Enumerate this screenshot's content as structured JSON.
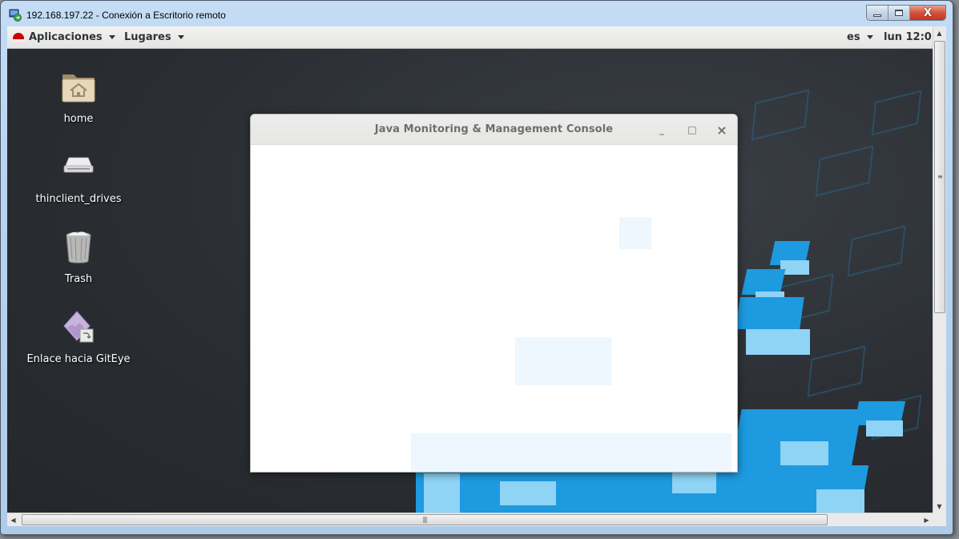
{
  "rdp_window": {
    "title": "192.168.197.22 - Conexión a Escritorio remoto",
    "icon": "remote-desktop-icon",
    "controls": {
      "minimize": "minimize-icon",
      "maximize": "maximize-icon",
      "close": "close-icon",
      "close_glyph": "X"
    }
  },
  "gnome_bar": {
    "menus": [
      {
        "label": "Aplicaciones",
        "icon": "redhat-icon"
      },
      {
        "label": "Lugares"
      }
    ],
    "language": "es",
    "clock": "lun 12:0"
  },
  "desktop": {
    "icons": [
      {
        "label": "home",
        "icon": "home-folder-icon"
      },
      {
        "label": "thinclient_drives",
        "icon": "drive-icon"
      },
      {
        "label": "Trash",
        "icon": "trash-icon"
      },
      {
        "label": "Enlace hacia GitEye",
        "icon": "giteye-link-icon"
      }
    ]
  },
  "app_window": {
    "title": "Java Monitoring & Management Console",
    "controls": {
      "minimize": "_",
      "maximize": "□",
      "close": "×"
    }
  },
  "scrollbars": {
    "vertical_grip": "≡",
    "horizontal_grip": "|||"
  }
}
